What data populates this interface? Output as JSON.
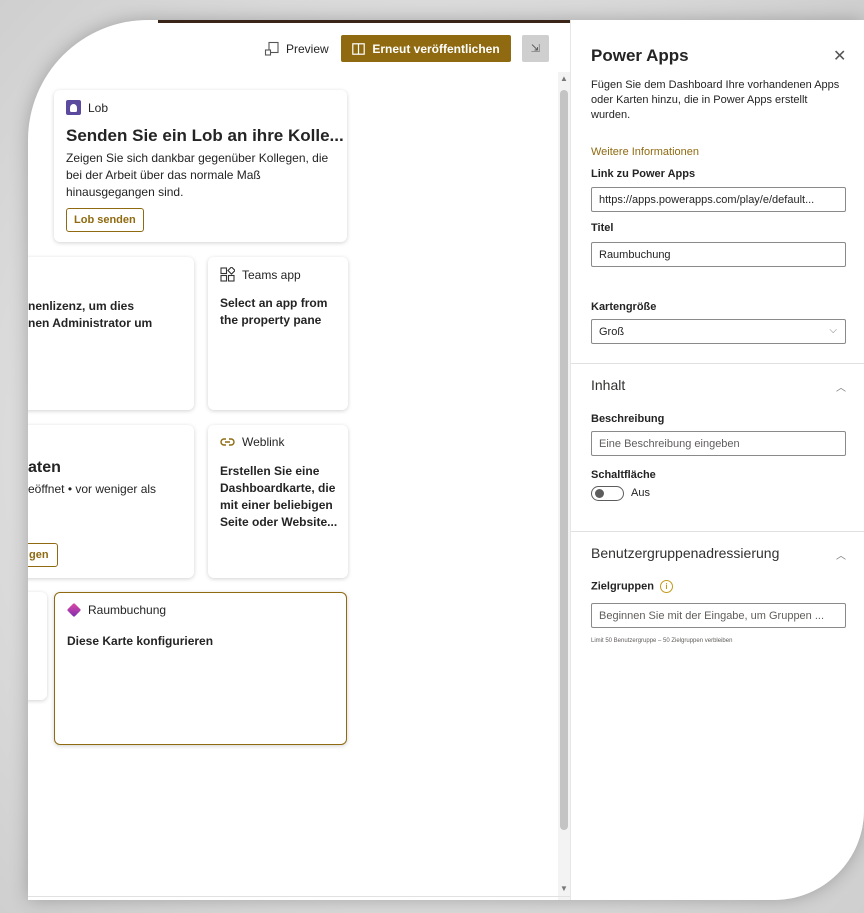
{
  "toolbar": {
    "preview_label": "Preview",
    "republish_label": "Erneut veröffentlichen"
  },
  "cards": {
    "lob": {
      "header": "Lob",
      "title": "Senden Sie ein Lob an ihre Kolle...",
      "description": "Zeigen Sie sich dankbar gegenüber Kollegen, die bei der Arbeit über das normale Maß hinausgegangen sind.",
      "button": "Lob senden"
    },
    "partial_left_1": {
      "line1": "nenlizenz, um dies",
      "line2": "nen Administrator um"
    },
    "teams": {
      "header": "Teams app",
      "body": "Select an app from the property pane"
    },
    "partial_left_2": {
      "title": "aten",
      "subtitle": "eöffnet • vor weniger als",
      "button": "gen"
    },
    "weblink": {
      "header": "Weblink",
      "body": "Erstellen Sie eine Dashboardkarte, die mit einer beliebigen Seite oder Website..."
    },
    "raumbuchung": {
      "header": "Raumbuchung",
      "body": "Diese Karte konfigurieren"
    }
  },
  "panel": {
    "title": "Power Apps",
    "intro": "Fügen Sie dem Dashboard Ihre vorhandenen Apps oder Karten hinzu, die in Power Apps erstellt wurden.",
    "more_info": "Weitere Informationen",
    "link_label": "Link zu Power Apps",
    "link_value": "https://apps.powerapps.com/play/e/default...",
    "title_label": "Titel",
    "title_value": "Raumbuchung",
    "size_label": "Kartengröße",
    "size_value": "Groß",
    "content_section": "Inhalt",
    "description_label": "Beschreibung",
    "description_placeholder": "Eine Beschreibung eingeben",
    "button_label": "Schaltfläche",
    "button_toggle": "Aus",
    "audience_section": "Benutzergruppenadressierung",
    "audience_label": "Zielgruppen",
    "audience_placeholder": "Beginnen Sie mit der Eingabe, um Gruppen ...",
    "audience_hint": "Limit 50 Benutzergruppe – 50 Zielgruppen verbleiben"
  },
  "colors": {
    "accent": "#8f6a10",
    "lob_icon": "#5c4a9e"
  }
}
